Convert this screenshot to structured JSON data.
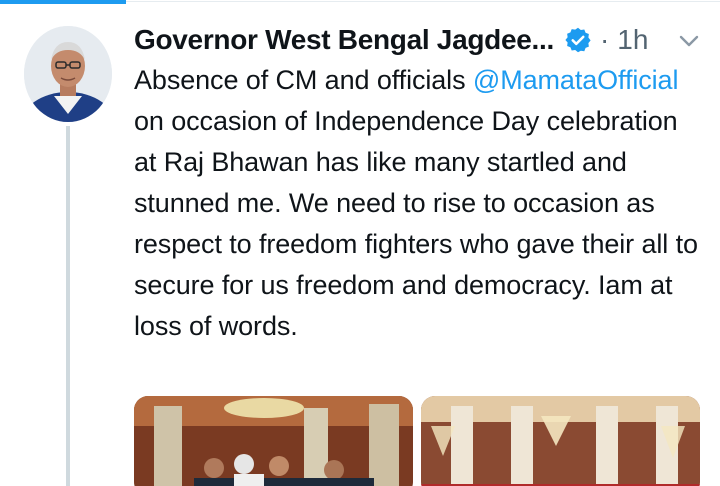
{
  "tweet": {
    "display_name": "Governor West Bengal Jagdee...",
    "separator": "·",
    "time": "1h",
    "text_before": "Absence of CM and officials ",
    "mention": "@MamataOfficial",
    "text_after": " on occasion of Independence Day celebration at Raj Bhawan has like many startled and stunned me. We need to rise to occasion as respect to freedom fighters who gave their all to secure for us freedom and democracy. Iam at loss of words."
  },
  "icons": {
    "verified": "verified-badge-icon",
    "more": "chevron-down-icon"
  },
  "colors": {
    "accent": "#1d9bf0",
    "text": "#0f1419",
    "secondary": "#536471",
    "thread_line": "#cfd9de"
  }
}
